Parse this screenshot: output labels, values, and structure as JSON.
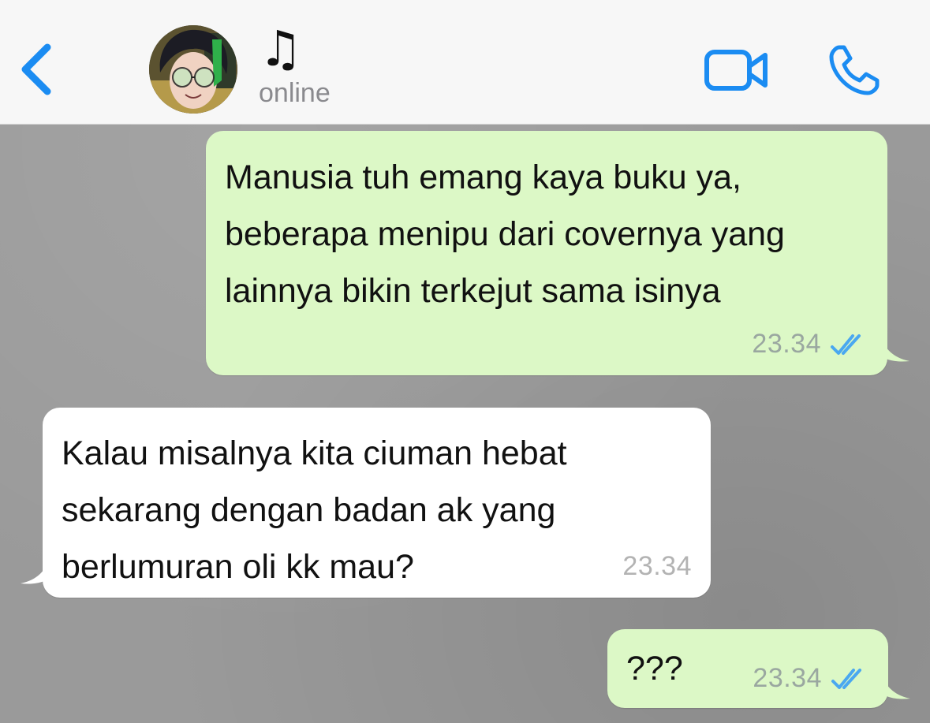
{
  "header": {
    "back_icon": "chevron-left-icon",
    "contact_name": "♫",
    "status": "online",
    "video_icon": "video-camera-icon",
    "phone_icon": "phone-icon",
    "accent_color": "#1b8cf2"
  },
  "messages": [
    {
      "direction": "outgoing",
      "text": "Manusia tuh emang kaya buku ya, beberapa menipu dari covernya yang lainnya bikin terkejut sama isinya",
      "time": "23.34",
      "status_icon": "double-check-icon",
      "color": "#dcf8c6"
    },
    {
      "direction": "incoming",
      "text": "Kalau misalnya kita ciuman hebat sekarang dengan badan ak yang berlumuran oli kk mau?",
      "time": "23.34",
      "color": "#ffffff"
    },
    {
      "direction": "outgoing",
      "text": "???",
      "time": "23.34",
      "status_icon": "double-check-icon",
      "color": "#dcf8c6"
    }
  ]
}
